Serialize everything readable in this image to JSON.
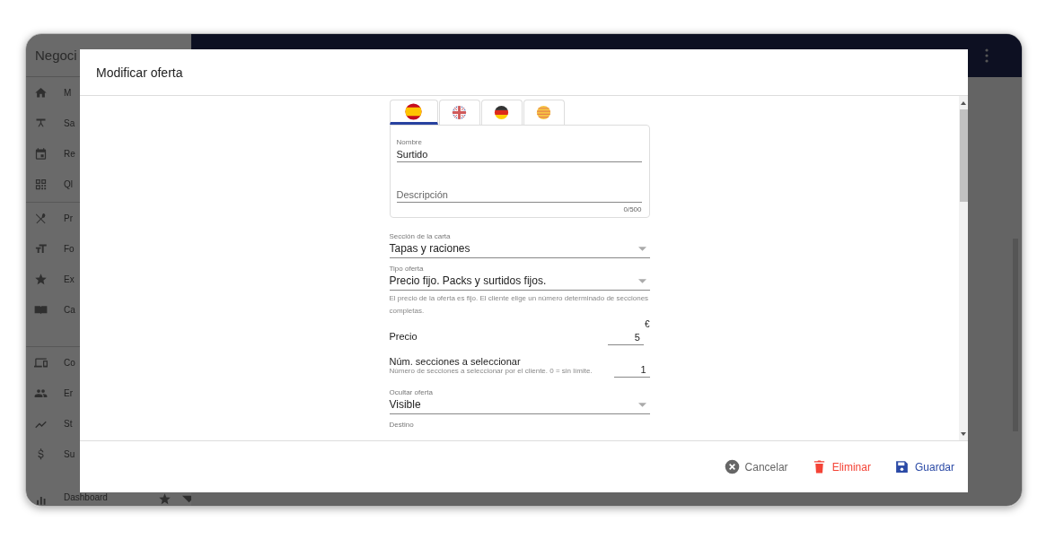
{
  "app": {
    "brand": "Negoci",
    "sidebar": [
      {
        "label": "M"
      },
      {
        "label": "Sa"
      },
      {
        "label": "Re"
      },
      {
        "label": "Ql"
      },
      {
        "label": "Pr"
      },
      {
        "label": "Fo"
      },
      {
        "label": "Ex"
      },
      {
        "label": "Ca"
      },
      {
        "label": "Co"
      },
      {
        "label": "Er"
      },
      {
        "label": "St"
      },
      {
        "label": "Su"
      },
      {
        "label": "Dashboard"
      }
    ]
  },
  "dialog": {
    "title": "Modificar oferta",
    "language_tabs": [
      {
        "selected": true
      },
      {
        "selected": false
      },
      {
        "selected": false
      },
      {
        "selected": false
      }
    ],
    "name_field": {
      "label": "Nombre",
      "value": "Surtido"
    },
    "description_field": {
      "placeholder": "Descripción",
      "counter": "0/500"
    },
    "fields": [
      {
        "kind": "select",
        "label": "Sección de la carta",
        "value": "Tapas y raciones"
      },
      {
        "kind": "select",
        "label": "Tipo oferta",
        "value": "Precio fijo. Packs y surtidos fijos.",
        "help": "El precio de la oferta es fijo. El cliente elige un número determinado de secciones completas."
      },
      {
        "kind": "price",
        "label": "Precio",
        "value": "5",
        "unit": "€"
      },
      {
        "kind": "number",
        "label": "Núm. secciones a seleccionar",
        "help": "Número de secciones a seleccionar por el cliente. 0 = sin límite.",
        "value": "1"
      },
      {
        "kind": "select",
        "label": "Ocultar oferta",
        "value": "Visible"
      },
      {
        "kind": "select",
        "label": "Destino"
      }
    ],
    "buttons": [
      {
        "kind": "cancel",
        "label": "Cancelar"
      },
      {
        "kind": "delete",
        "label": "Eliminar"
      },
      {
        "kind": "save",
        "label": "Guardar"
      }
    ]
  }
}
